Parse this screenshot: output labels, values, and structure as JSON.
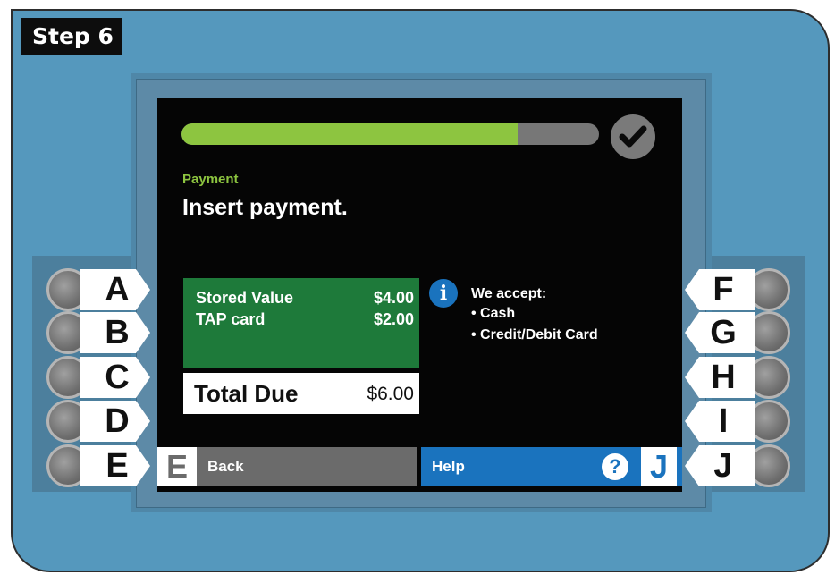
{
  "step_tag": "Step 6",
  "screen": {
    "progress": {
      "value": 0.805
    },
    "step_label": "Payment",
    "headline": "Insert payment.",
    "stored": [
      {
        "label": "Stored Value",
        "amount": "$4.00"
      },
      {
        "label": "TAP card",
        "amount": "$2.00"
      }
    ],
    "total": {
      "label": "Total Due",
      "amount": "$6.00"
    },
    "accept": {
      "title": "We accept:",
      "items": [
        "• Cash",
        "• Credit/Debit Card"
      ]
    },
    "back_button": {
      "letter": "E",
      "label": "Back"
    },
    "help_button": {
      "label": "Help",
      "icon": "?",
      "letter": "J"
    }
  },
  "hardware_buttons": {
    "left": [
      "A",
      "B",
      "C",
      "D",
      "E"
    ],
    "right": [
      "F",
      "G",
      "H",
      "I",
      "J"
    ]
  },
  "colors": {
    "machine": "#5598bd",
    "progress_fill": "#8dc540",
    "stored_box": "#1e7a3a",
    "help_blue": "#1a73be",
    "back_gray": "#6b6b6b"
  },
  "icons": {
    "check": "check-icon",
    "info": "info-icon",
    "help": "question-icon"
  }
}
